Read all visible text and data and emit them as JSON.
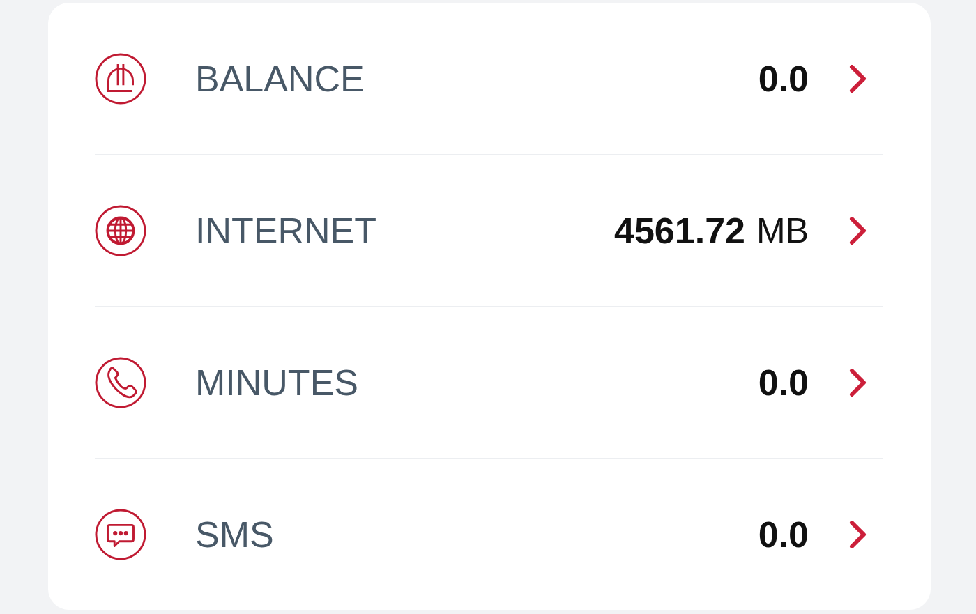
{
  "items": [
    {
      "label": "BALANCE",
      "amount": "0.0"
    },
    {
      "label": "INTERNET",
      "amount": "4561.72",
      "unit": "MB"
    },
    {
      "label": "MINUTES",
      "amount": "0.0"
    },
    {
      "label": "SMS",
      "amount": "0.0"
    }
  ]
}
